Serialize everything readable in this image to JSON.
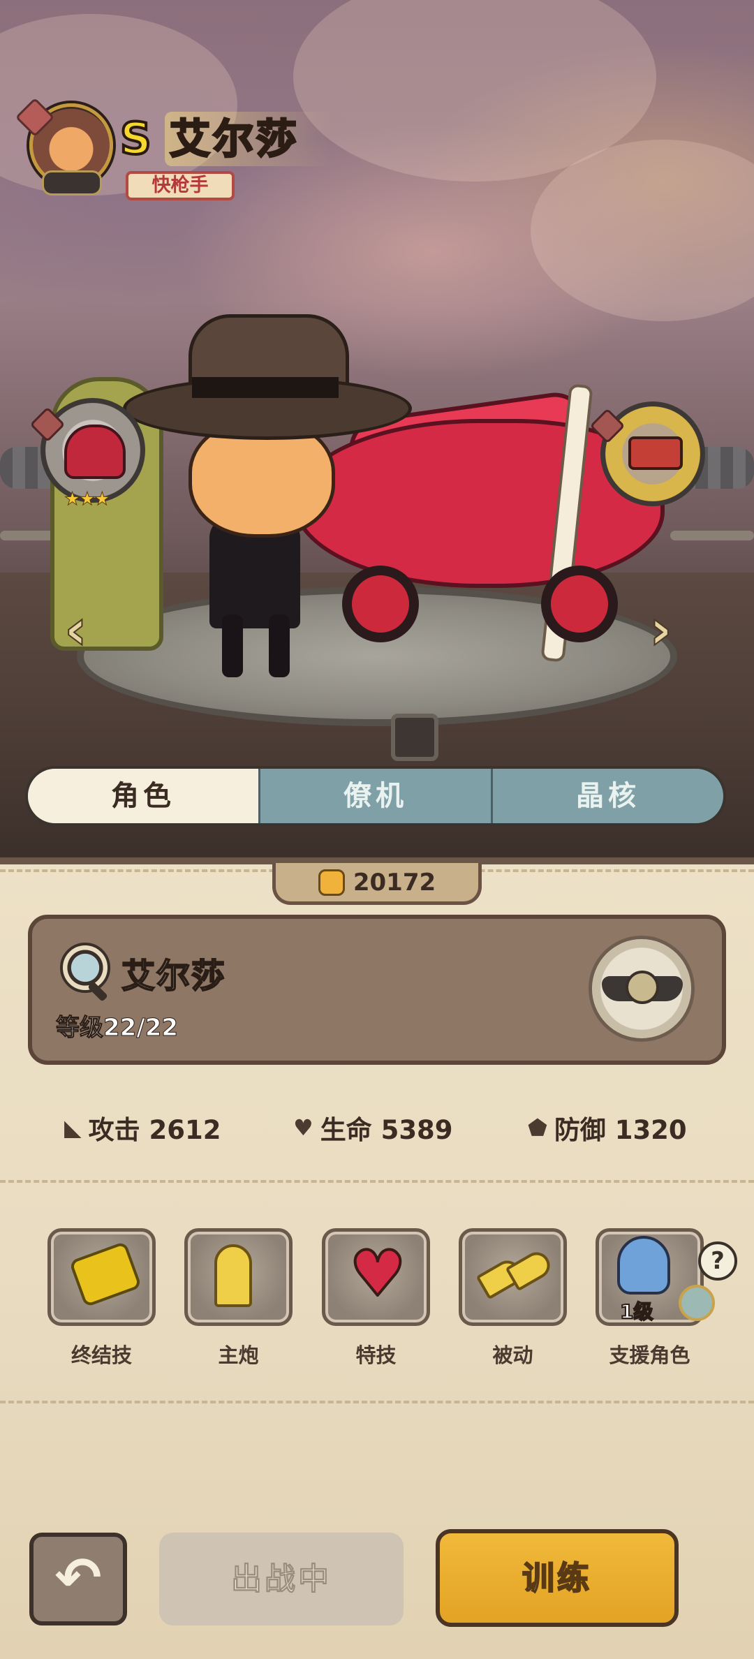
{
  "hero": {
    "rank": "S",
    "name": "艾尔莎",
    "class": "快枪手"
  },
  "nav": {
    "prev_icon": "chevron-left-icon",
    "next_icon": "chevron-right-icon",
    "prev_glyph": "‹",
    "next_glyph": "›"
  },
  "tabs": [
    {
      "label": "角色",
      "active": true
    },
    {
      "label": "僚机",
      "active": false
    },
    {
      "label": "晶核",
      "active": false
    }
  ],
  "currency": {
    "icon": "fist-icon",
    "value": "20172"
  },
  "info": {
    "name": "艾尔莎",
    "level": "等级22/22"
  },
  "stats": [
    {
      "icon": "attack-icon",
      "glyph": "◣",
      "label": "攻击 2612"
    },
    {
      "icon": "heart-icon",
      "glyph": "♥",
      "label": "生命 5389"
    },
    {
      "icon": "shield-icon",
      "glyph": "⬟",
      "label": "防御 1320"
    }
  ],
  "skills": [
    {
      "label": "终结技"
    },
    {
      "label": "主炮"
    },
    {
      "label": "特技"
    },
    {
      "label": "被动"
    },
    {
      "label": "支援角色",
      "level": "1级"
    }
  ],
  "help_glyph": "?",
  "buttons": {
    "back_glyph": "↶",
    "deploy": "出战中",
    "train": "训练"
  },
  "colors": {
    "accent_gold": "#e3a324",
    "active_tab": "#f6efdd",
    "inactive_tab": "#7fa0a7",
    "class_tag_red": "#b5383b"
  }
}
